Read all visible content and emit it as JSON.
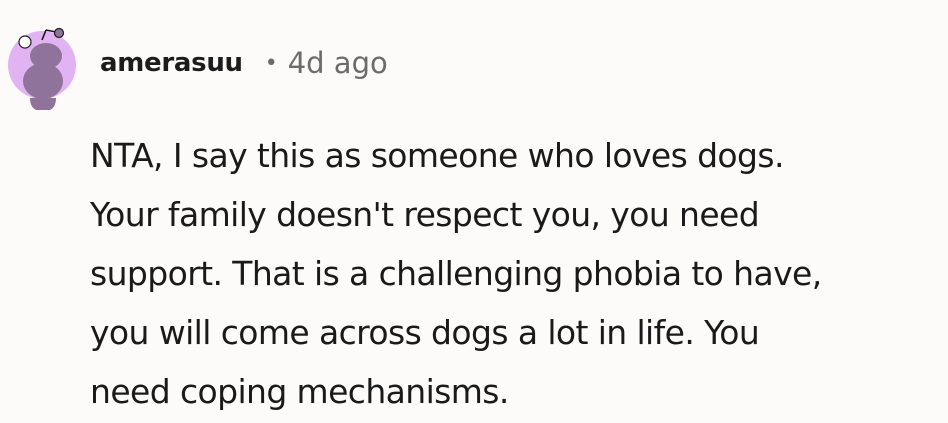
{
  "comment": {
    "author": "amerasuu",
    "separator": "•",
    "timestamp": "4d ago",
    "avatar_icon": "snoo-avatar-icon",
    "avatar_color": "#e2b3f2",
    "body_lines": [
      "NTA, I say this as someone who loves dogs.",
      "Your family doesn't respect you, you need",
      "support. That is a challenging phobia to have,",
      "you will come across dogs a lot in life. You",
      "need coping mechanisms."
    ]
  }
}
